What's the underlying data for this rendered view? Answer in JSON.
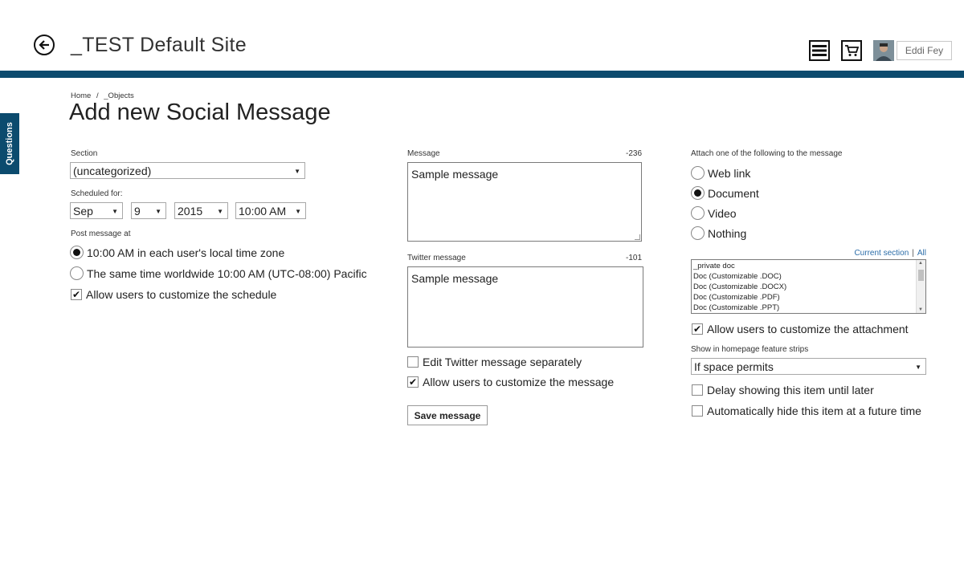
{
  "header": {
    "site_title": "_TEST Default Site",
    "back_icon": "back-arrow-icon",
    "menu_icon": "menu-icon",
    "cart_icon": "cart-icon",
    "user_name": "Eddi Fey",
    "accent_color": "#0c4b6e"
  },
  "side_tab": {
    "label": "Questions"
  },
  "breadcrumb": {
    "home": "Home",
    "separator": "/",
    "objects": "_Objects"
  },
  "page": {
    "title": "Add new Social Message"
  },
  "left": {
    "section_label": "Section",
    "section_value": "(uncategorized)",
    "scheduled_label": "Scheduled for:",
    "month": "Sep",
    "day": "9",
    "year": "2015",
    "time": "10:00 AM",
    "post_label": "Post message at",
    "option_local": "10:00 AM in each user's local time zone",
    "option_worldwide": "The same time worldwide 10:00 AM (UTC-08:00) Pacific",
    "allow_schedule": "Allow users to customize the schedule"
  },
  "middle": {
    "message_label": "Message",
    "message_counter": "-236",
    "message_value": "Sample message",
    "twitter_label": "Twitter message",
    "twitter_counter": "-101",
    "twitter_value": "Sample message",
    "edit_twitter": "Edit Twitter message separately",
    "allow_message": "Allow users to customize the message",
    "save_label": "Save message"
  },
  "right": {
    "attach_label": "Attach one of the following to the message",
    "opt_weblink": "Web link",
    "opt_document": "Document",
    "opt_video": "Video",
    "opt_nothing": "Nothing",
    "current_section": "Current section",
    "links_sep": "|",
    "all": "All",
    "documents": [
      "_private doc",
      "Doc (Customizable .DOC)",
      "Doc (Customizable .DOCX)",
      "Doc (Customizable .PDF)",
      "Doc (Customizable .PPT)"
    ],
    "allow_attachment": "Allow users to customize the attachment",
    "show_label": "Show in homepage feature strips",
    "show_value": "If space permits",
    "delay": "Delay showing this item until later",
    "auto_hide": "Automatically hide this item at a future time"
  }
}
